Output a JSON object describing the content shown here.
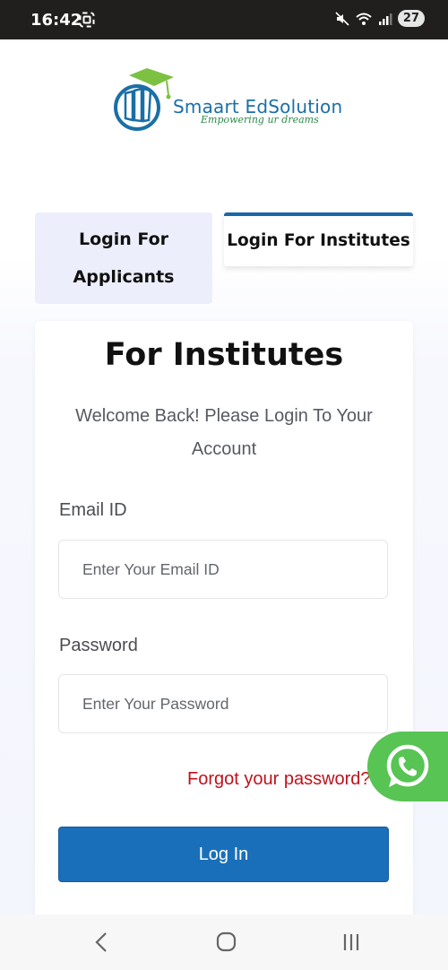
{
  "status_bar": {
    "time": "16:42",
    "battery": "27"
  },
  "logo": {
    "brand": "Smaart EdSolution",
    "tagline": "Empowering ur dreams"
  },
  "tabs": [
    {
      "label": "Login For Applicants",
      "active": false
    },
    {
      "label": "Login For Institutes",
      "active": true
    }
  ],
  "form": {
    "title": "For Institutes",
    "subtitle": "Welcome Back! Please Login To Your Account",
    "email_label": "Email ID",
    "email_placeholder": "Enter Your Email ID",
    "password_label": "Password",
    "password_placeholder": "Enter Your Password",
    "forgot_label": "Forgot your password?",
    "login_label": "Log In"
  },
  "colors": {
    "primary": "#1a6fbb",
    "tab_active_border": "#1a68a8",
    "forgot_link": "#c0121c",
    "whatsapp": "#57c454"
  },
  "icons": {
    "whatsapp": "whatsapp-icon",
    "nav_back": "back-icon",
    "nav_home": "home-icon",
    "nav_recents": "recents-icon"
  }
}
